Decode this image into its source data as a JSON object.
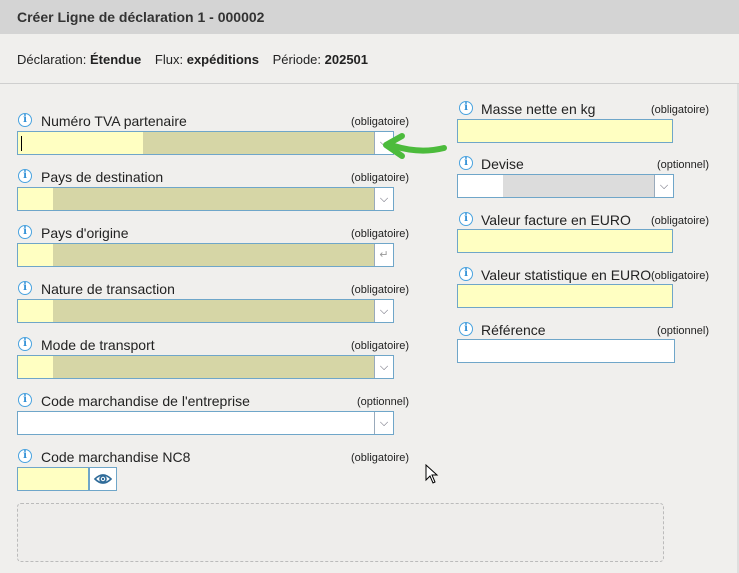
{
  "window": {
    "title": "Créer Ligne de déclaration 1 - 000002"
  },
  "info": {
    "declaration_label": "Déclaration:",
    "declaration_value": "Étendue",
    "flux_label": "Flux:",
    "flux_value": "expéditions",
    "periode_label": "Période:",
    "periode_value": "202501"
  },
  "icons": {
    "info": "i"
  },
  "left_fields": [
    {
      "label": "Numéro TVA partenaire",
      "requirement": "(obligatoire)"
    },
    {
      "label": "Pays de destination",
      "requirement": "(obligatoire)"
    },
    {
      "label": "Pays d'origine",
      "requirement": "(obligatoire)"
    },
    {
      "label": "Nature de transaction",
      "requirement": "(obligatoire)"
    },
    {
      "label": "Mode de transport",
      "requirement": "(obligatoire)"
    },
    {
      "label": "Code marchandise de l'entreprise",
      "requirement": "(optionnel)"
    },
    {
      "label": "Code marchandise NC8",
      "requirement": "(obligatoire)"
    }
  ],
  "right_fields": [
    {
      "label": "Masse nette en kg",
      "requirement": "(obligatoire)"
    },
    {
      "label": "Devise",
      "requirement": "(optionnel)"
    },
    {
      "label": "Valeur facture en EURO",
      "requirement": "(obligatoire)"
    },
    {
      "label": "Valeur statistique en EURO",
      "requirement": "(obligatoire)"
    },
    {
      "label": "Référence",
      "requirement": "(optionnel)"
    }
  ],
  "colors": {
    "required_fill": "#ffffc2",
    "autocomplete_fill": "#d6d6a6",
    "field_border": "#6fa6c9",
    "arrow_annotation": "#4cbb3c"
  }
}
